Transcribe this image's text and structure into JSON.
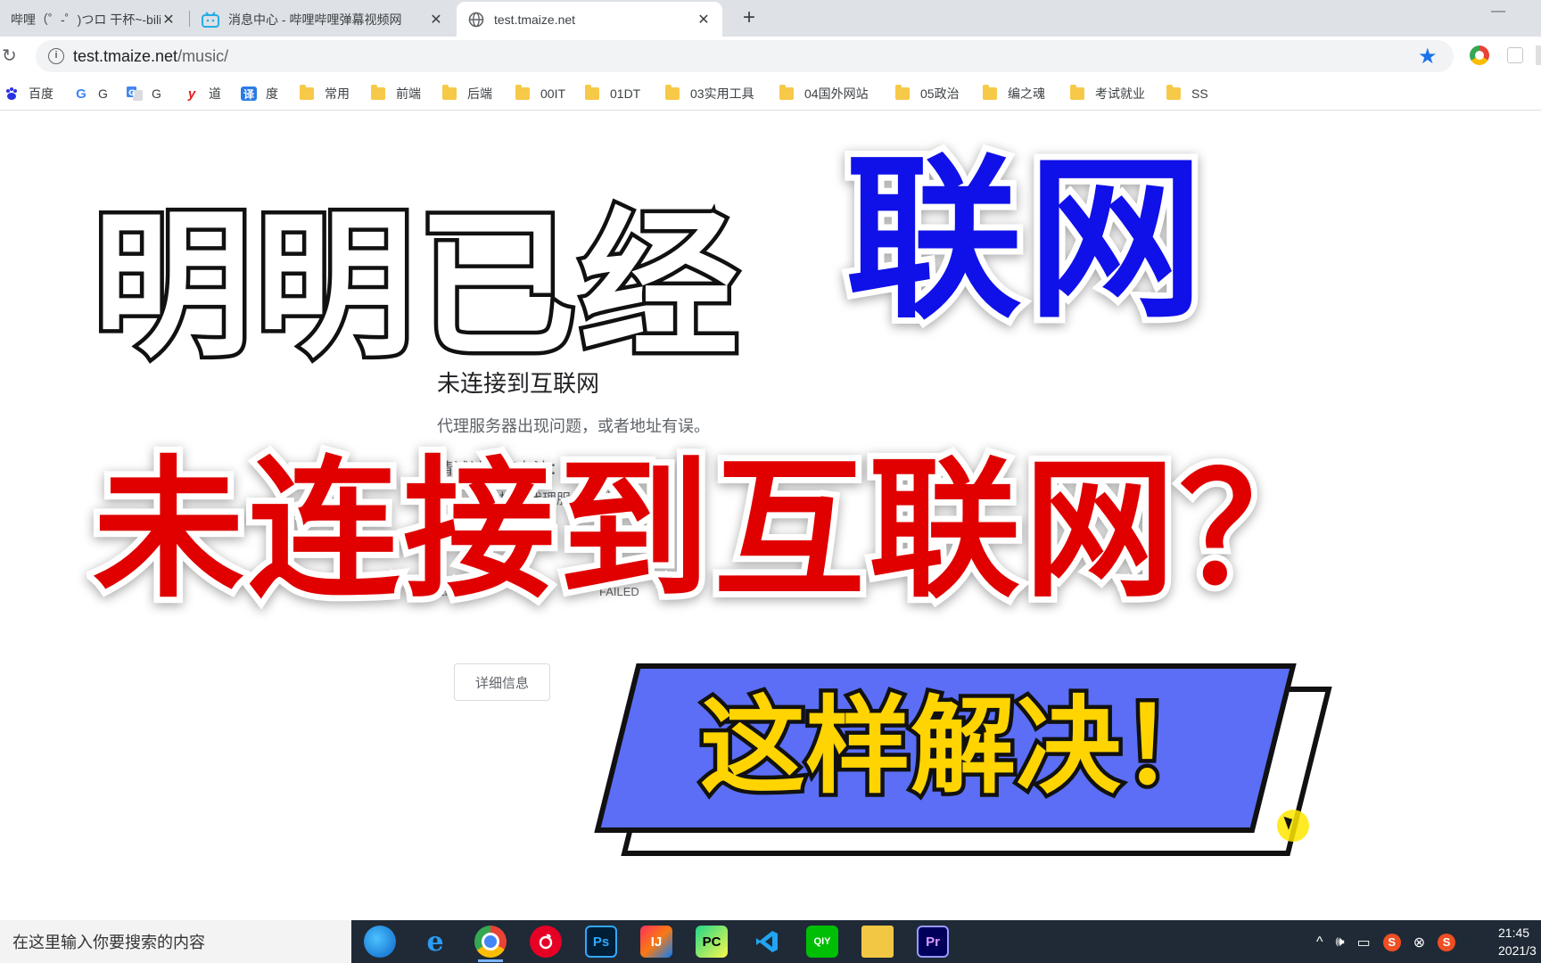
{
  "browser": {
    "tabs": [
      {
        "title": "哔哩（゜-゜)つロ 干杯~-bilibili"
      },
      {
        "title": "消息中心 - 哔哩哔哩弹幕视频网"
      },
      {
        "title": "test.tmaize.net",
        "active": true
      }
    ],
    "new_tab": "+",
    "close_glyph": "✕",
    "url_host": "test.tmaize.net",
    "url_path": "/music/"
  },
  "bookmarks": [
    {
      "label": "百度",
      "icon": "baidu-icon"
    },
    {
      "label": "G",
      "icon": "google-icon"
    },
    {
      "label": "G",
      "icon": "google-translate-icon"
    },
    {
      "label": "道",
      "icon": "youdao-icon"
    },
    {
      "label": "度",
      "icon": "translate-icon"
    },
    {
      "label": "常用",
      "icon": "folder-icon"
    },
    {
      "label": "前端",
      "icon": "folder-icon"
    },
    {
      "label": "后端",
      "icon": "folder-icon"
    },
    {
      "label": "00IT",
      "icon": "folder-icon"
    },
    {
      "label": "01DT",
      "icon": "folder-icon"
    },
    {
      "label": "03实用工具",
      "icon": "folder-icon"
    },
    {
      "label": "04国外网站",
      "icon": "folder-icon"
    },
    {
      "label": "05政治",
      "icon": "folder-icon"
    },
    {
      "label": "编之魂",
      "icon": "folder-icon"
    },
    {
      "label": "考试就业",
      "icon": "folder-icon"
    },
    {
      "label": "SS",
      "icon": "folder-icon"
    }
  ],
  "error_page": {
    "heading": "未连接到互联网",
    "description": "代理服务器出现问题，或者地址有误。",
    "try_label": "请试试以下办法：",
    "suggestion": "检查代理服务器地址",
    "code_left": "ERR",
    "code_right": "FAILED",
    "details_button": "详细信息"
  },
  "overlay": {
    "line1": "明明已经",
    "highlight": "联网",
    "line2": "未连接到互联网？",
    "banner": "这样解决！"
  },
  "taskbar": {
    "search_placeholder": "在这里输入你要搜索的内容",
    "apps": [
      {
        "name": "edge-icon",
        "glyph": ""
      },
      {
        "name": "ie-icon",
        "glyph": "e"
      },
      {
        "name": "chrome-icon",
        "glyph": ""
      },
      {
        "name": "netease-music-icon",
        "glyph": ""
      },
      {
        "name": "photoshop-icon",
        "glyph": "Ps"
      },
      {
        "name": "intellij-icon",
        "glyph": "IJ"
      },
      {
        "name": "pycharm-icon",
        "glyph": "PC"
      },
      {
        "name": "vscode-icon",
        "glyph": ""
      },
      {
        "name": "iqiyi-icon",
        "glyph": "QIY"
      },
      {
        "name": "file-explorer-icon",
        "glyph": ""
      },
      {
        "name": "premiere-icon",
        "glyph": "Pr"
      }
    ],
    "tray": {
      "chevron": "^",
      "volume": "🕪",
      "battery": "▭",
      "ime_1": "S",
      "close": "⊗",
      "ime_2": "S"
    },
    "clock_time": "21:45",
    "clock_date": "2021/3"
  },
  "colors": {
    "accent_blue": "#1010e8",
    "accent_red": "#e00000",
    "banner_blue": "#5b6ef5",
    "banner_text": "#ffd400",
    "star": "#1a73e8"
  }
}
